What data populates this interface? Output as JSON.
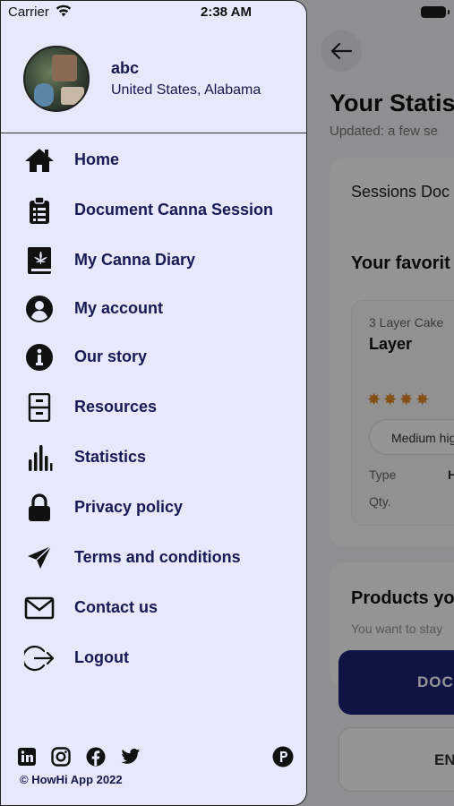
{
  "status_bar": {
    "carrier": "Carrier",
    "time": "2:38 AM"
  },
  "profile": {
    "name": "abc",
    "location": "United States, Alabama"
  },
  "menu": {
    "items": [
      {
        "label": "Home",
        "icon": "home-icon"
      },
      {
        "label": "Document Canna Session",
        "icon": "clipboard-icon"
      },
      {
        "label": "My Canna Diary",
        "icon": "diary-book-icon"
      },
      {
        "label": "My account",
        "icon": "account-circle-icon"
      },
      {
        "label": "Our story",
        "icon": "info-icon"
      },
      {
        "label": "Resources",
        "icon": "file-cabinet-icon"
      },
      {
        "label": "Statistics",
        "icon": "bar-chart-icon"
      },
      {
        "label": "Privacy policy",
        "icon": "lock-icon"
      },
      {
        "label": "Terms and conditions",
        "icon": "paper-plane-icon"
      },
      {
        "label": "Contact us",
        "icon": "envelope-icon"
      },
      {
        "label": "Logout",
        "icon": "logout-icon"
      }
    ]
  },
  "footer": {
    "social": [
      "linkedin-icon",
      "instagram-icon",
      "facebook-icon",
      "twitter-icon",
      "pinterest-icon"
    ],
    "copyright": "© HowHi App 2022"
  },
  "background_screen": {
    "title": "Your Statist",
    "updated": "Updated: a few se",
    "sessions_label": "Sessions Doc",
    "favorite_label": "Your favorit",
    "product_subtitle": "3 Layer Cake",
    "product_name": "Layer",
    "pill_label": "Medium hig",
    "type_label": "Type",
    "type_value": "H",
    "qty_label": "Qty.",
    "products_label": "Products yo",
    "products_hint": "You want to stay",
    "document_button": "DOC",
    "en_button": "EN"
  },
  "colors": {
    "drawer_bg": "#e7e8f9",
    "text_navy": "#15184d",
    "accent_button": "#1c2378"
  }
}
